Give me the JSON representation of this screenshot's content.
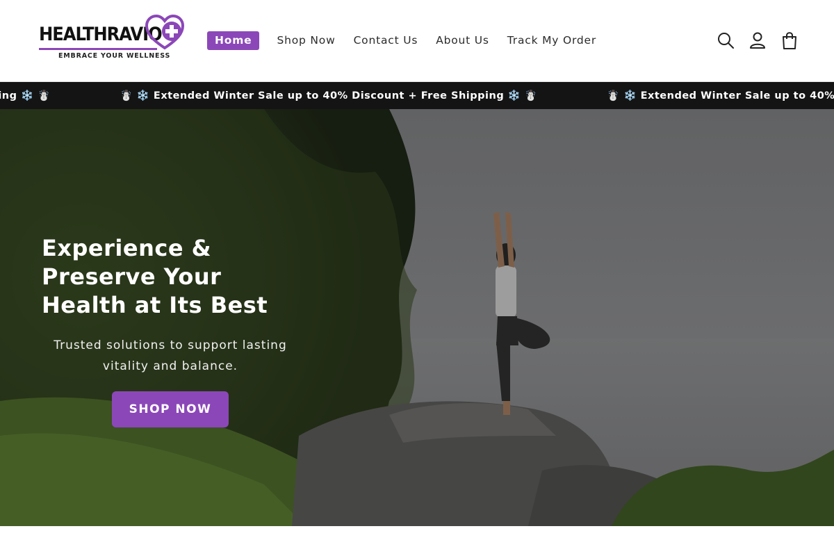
{
  "brand": {
    "name": "HEALTHRAVIO",
    "tagline": "EMBRACE YOUR WELLNESS",
    "accent_color": "#8b47b8"
  },
  "nav": {
    "items": [
      {
        "label": "Home",
        "active": true
      },
      {
        "label": "Shop Now",
        "active": false
      },
      {
        "label": "Contact Us",
        "active": false
      },
      {
        "label": "About Us",
        "active": false
      },
      {
        "label": "Track My Order",
        "active": false
      }
    ]
  },
  "header_icons": [
    "search-icon",
    "account-icon",
    "cart-icon"
  ],
  "announcement": {
    "text": "☃️ ❄️ Extended Winter Sale up to 40% Discount + Free Shipping ❄️ ☃️",
    "background": "#141414"
  },
  "hero": {
    "title": "Experience & Preserve Your Health at Its Best",
    "subtitle": "Trusted solutions to support lasting vitality and balance.",
    "button_label": "SHOP NOW"
  }
}
